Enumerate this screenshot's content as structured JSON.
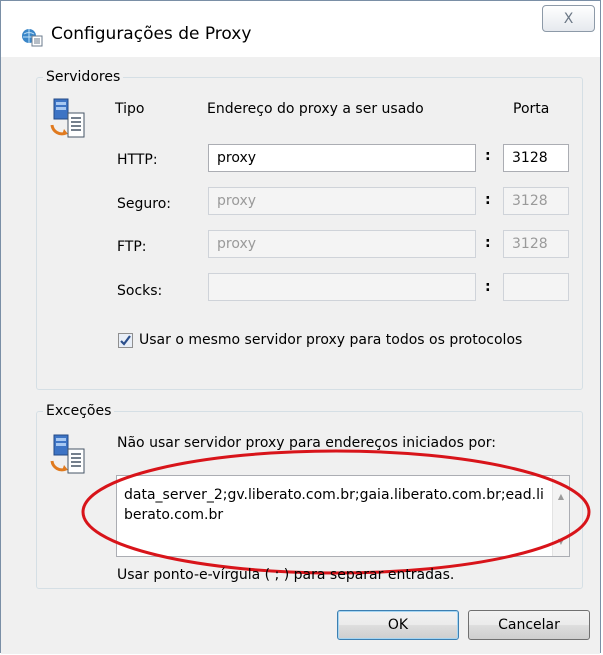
{
  "window": {
    "title": "Configurações de Proxy",
    "close_glyph": "X"
  },
  "servers": {
    "legend": "Servidores",
    "col_type": "Tipo",
    "col_address": "Endereço do proxy a ser usado",
    "col_port": "Porta",
    "rows": [
      {
        "label": "HTTP:",
        "address": "proxy",
        "port": "3128",
        "enabled": true
      },
      {
        "label": "Seguro:",
        "address": "proxy",
        "port": "3128",
        "enabled": false
      },
      {
        "label": "FTP:",
        "address": "proxy",
        "port": "3128",
        "enabled": false
      },
      {
        "label": "Socks:",
        "address": "",
        "port": "",
        "enabled": false
      }
    ],
    "colon": ":",
    "same_proxy_label": "Usar o mesmo servidor proxy para todos os protocolos",
    "same_proxy_checked": true
  },
  "exceptions": {
    "legend": "Exceções",
    "instruction": "Não usar servidor proxy para endereços iniciados por:",
    "value": "data_server_2;gv.liberato.com.br;gaia.liberato.com.br;ead.liberato.com.br",
    "hint": "Usar ponto-e-vírgula ( ; ) para separar entradas."
  },
  "buttons": {
    "ok": "OK",
    "cancel": "Cancelar"
  },
  "colors": {
    "annotation": "#d8141a",
    "window_bg": "#f0f0f0"
  },
  "icons": {
    "title": "proxy-settings-icon",
    "servers": "server-document-icon",
    "exceptions": "server-document-icon",
    "checkbox": "checkmark-icon",
    "scroll_up": "scroll-up-arrow-icon",
    "scroll_down": "scroll-down-arrow-icon"
  }
}
